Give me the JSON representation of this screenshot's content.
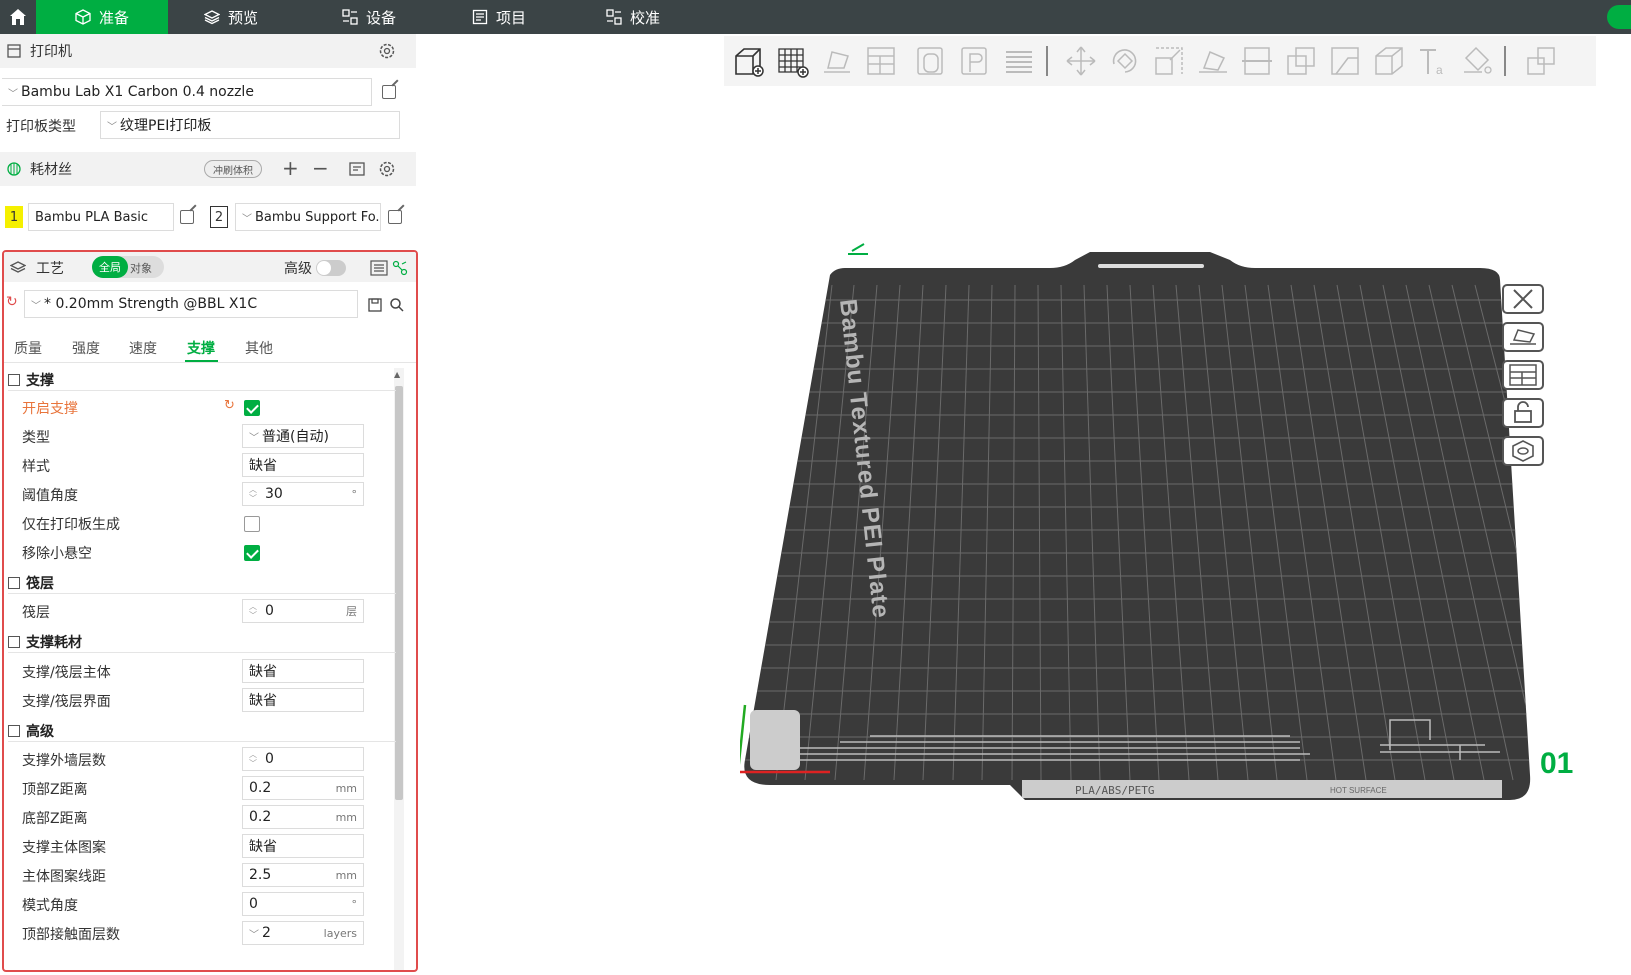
{
  "topbar": {
    "tabs": [
      {
        "label": "准备",
        "icon": "cube-icon",
        "active": true
      },
      {
        "label": "预览",
        "icon": "layers-icon",
        "active": false
      },
      {
        "label": "设备",
        "icon": "device-icon",
        "active": false
      },
      {
        "label": "项目",
        "icon": "project-icon",
        "active": false
      },
      {
        "label": "校准",
        "icon": "calibrate-icon",
        "active": false
      }
    ],
    "accent": "#00ae42"
  },
  "printer": {
    "section_title": "打印机",
    "model": "Bambu Lab X1 Carbon 0.4 nozzle",
    "plate_type_label": "打印板类型",
    "plate_type": "纹理PEI打印板"
  },
  "filament": {
    "section_title": "耗材丝",
    "flush_button": "冲刷体积",
    "slots": [
      {
        "index": "1",
        "name": "Bambu PLA Basic",
        "color": "#f5f000"
      },
      {
        "index": "2",
        "name": "Bambu Support Fo...",
        "color": "#ffffff"
      }
    ]
  },
  "process": {
    "section_title": "工艺",
    "toggle_global": "全局",
    "toggle_object": "对象",
    "advanced_label": "高级",
    "preset": "* 0.20mm Strength @BBL X1C",
    "tabs": [
      "质量",
      "强度",
      "速度",
      "支撑",
      "其他"
    ],
    "active_tab": "支撑",
    "groups": {
      "support": "支撑",
      "raft": "筏层",
      "support_filament": "支撑耗材",
      "advanced": "高级"
    },
    "fields": {
      "enable_support": {
        "label": "开启支撑",
        "checked": true
      },
      "type": {
        "label": "类型",
        "value": "普通(自动)"
      },
      "style": {
        "label": "样式",
        "value": "缺省"
      },
      "threshold": {
        "label": "阈值角度",
        "value": "30",
        "unit": "°"
      },
      "on_build_plate": {
        "label": "仅在打印板生成",
        "checked": false
      },
      "remove_small": {
        "label": "移除小悬空",
        "checked": true
      },
      "raft_layers": {
        "label": "筏层",
        "value": "0",
        "unit": "层"
      },
      "support_base": {
        "label": "支撑/筏层主体",
        "value": "缺省"
      },
      "support_interface": {
        "label": "支撑/筏层界面",
        "value": "缺省"
      },
      "wall_loops": {
        "label": "支撑外墙层数",
        "value": "0"
      },
      "top_z": {
        "label": "顶部Z距离",
        "value": "0.2",
        "unit": "mm"
      },
      "bottom_z": {
        "label": "底部Z距离",
        "value": "0.2",
        "unit": "mm"
      },
      "base_pattern": {
        "label": "支撑主体图案",
        "value": "缺省"
      },
      "base_spacing": {
        "label": "主体图案线距",
        "value": "2.5",
        "unit": "mm"
      },
      "pattern_angle": {
        "label": "模式角度",
        "value": "0",
        "unit": "°"
      },
      "top_interface_layers": {
        "label": "顶部接触面层数",
        "value": "2",
        "unit": "layers"
      }
    }
  },
  "viewport": {
    "plate_text": "Bambu Textured PEI Plate",
    "plate_number": "01",
    "plate_label_strip": "PLA/ABS/PETG",
    "hot_surface": "HOT SURFACE"
  }
}
